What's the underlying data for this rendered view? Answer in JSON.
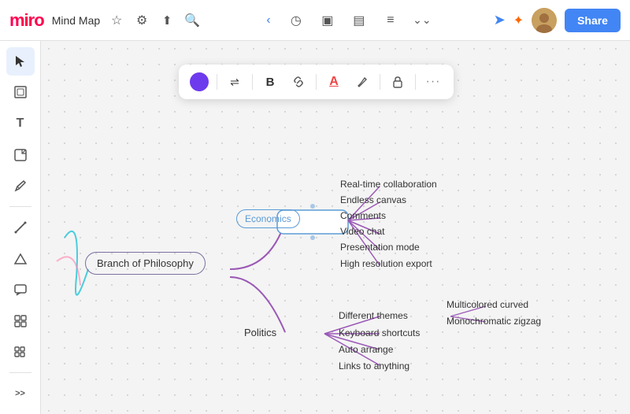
{
  "topbar": {
    "logo": "miro",
    "project_name": "Mind Map",
    "star_icon": "★",
    "settings_icon": "⚙",
    "upload_icon": "⬆",
    "search_icon": "🔍",
    "share_label": "Share",
    "nav_icons": [
      "◷",
      "▣",
      "▤",
      "≡",
      "⌄⌄"
    ]
  },
  "sidebar": {
    "items": [
      {
        "name": "cursor",
        "icon": "▲",
        "active": true
      },
      {
        "name": "frame",
        "icon": "▭"
      },
      {
        "name": "text",
        "icon": "T"
      },
      {
        "name": "sticky",
        "icon": "⎕"
      },
      {
        "name": "pen",
        "icon": "✏"
      },
      {
        "name": "line",
        "icon": "/"
      },
      {
        "name": "shape",
        "icon": "△"
      },
      {
        "name": "comment",
        "icon": "💬"
      },
      {
        "name": "grid",
        "icon": "⊞"
      },
      {
        "name": "more",
        "icon": ">>"
      }
    ]
  },
  "float_toolbar": {
    "circle_color": "#6e3aed",
    "align_icon": "⇌",
    "bold_icon": "B",
    "link_icon": "🔗",
    "text_color_icon": "A",
    "highlight_icon": "✏",
    "lock_icon": "🔒",
    "more_icon": "···"
  },
  "mindmap": {
    "root": "Branch of Philosophy",
    "branches": [
      {
        "label": "Economics",
        "children": [
          "Real-time collaboration",
          "Endless canvas",
          "Comments",
          "Video chat",
          "Presentation mode",
          "High resolution export"
        ]
      },
      {
        "label": "Politics",
        "children": [
          "Different themes",
          "Keyboard shortcuts",
          "Auto arrange",
          "Links to anything"
        ],
        "sub_branches": [
          {
            "parent": "Different themes",
            "children": [
              "Multicolored curved",
              "Monochromatic zigzag"
            ]
          }
        ]
      }
    ]
  }
}
